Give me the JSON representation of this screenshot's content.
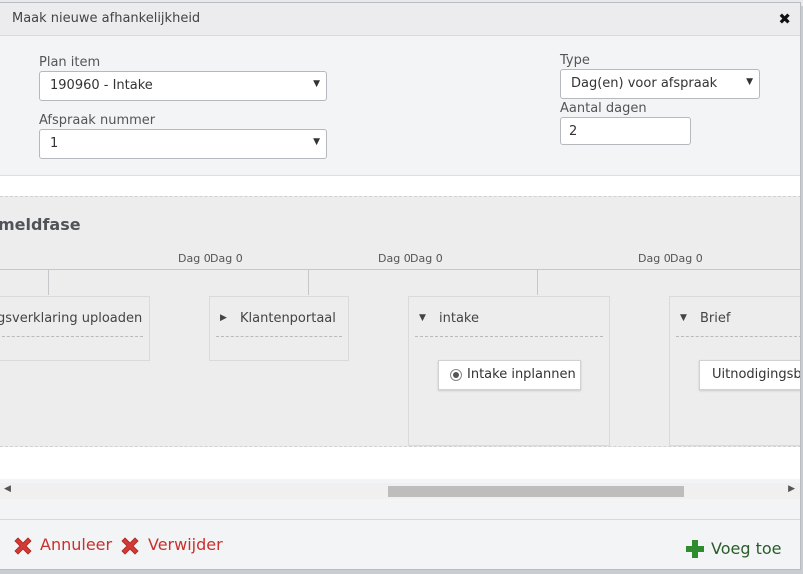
{
  "dialog": {
    "title": "Maak nieuwe afhankelijkheid",
    "close_glyph": "✖"
  },
  "form": {
    "plan_item_label": "Plan item",
    "plan_item_value": "190960 - Intake",
    "afspraak_label": "Afspraak nummer",
    "afspraak_value": "1",
    "type_label": "Type",
    "type_value": "Dag(en) voor afspraak",
    "aantal_label": "Aantal dagen",
    "aantal_value": "2"
  },
  "phase": {
    "title": "meldfase",
    "dag_labels": [
      "Dag 0",
      "Dag 0",
      "Dag 0",
      "Dag 0",
      "Dag 0",
      "Dag 0"
    ],
    "columns": [
      {
        "title": "gsverklaring uploaden",
        "expanded": false
      },
      {
        "title": "Klantenportaal",
        "expanded": false,
        "arrow": "▶"
      },
      {
        "title": "intake",
        "expanded": true,
        "arrow": "▼",
        "card": "Intake inplannen"
      },
      {
        "title": "Brief",
        "expanded": true,
        "arrow": "▼",
        "card": "Uitnodigingsbrief"
      }
    ]
  },
  "scrollbar": {
    "left_arrow": "◀",
    "right_arrow": "▶",
    "thumb_fraction_start": 0.485,
    "thumb_fraction_size": 0.37
  },
  "footer": {
    "cancel_label": "Annuleer",
    "delete_label": "Verwijder",
    "add_label": "Voeg toe"
  },
  "colors": {
    "danger": "#c9302c",
    "success": "#2e8b2e",
    "panel_bg": "#ededed"
  },
  "icons": {
    "close": "close-icon",
    "cancel": "x-icon",
    "delete": "x-icon",
    "add": "plus-icon",
    "select_caret": "caret-down-icon"
  }
}
